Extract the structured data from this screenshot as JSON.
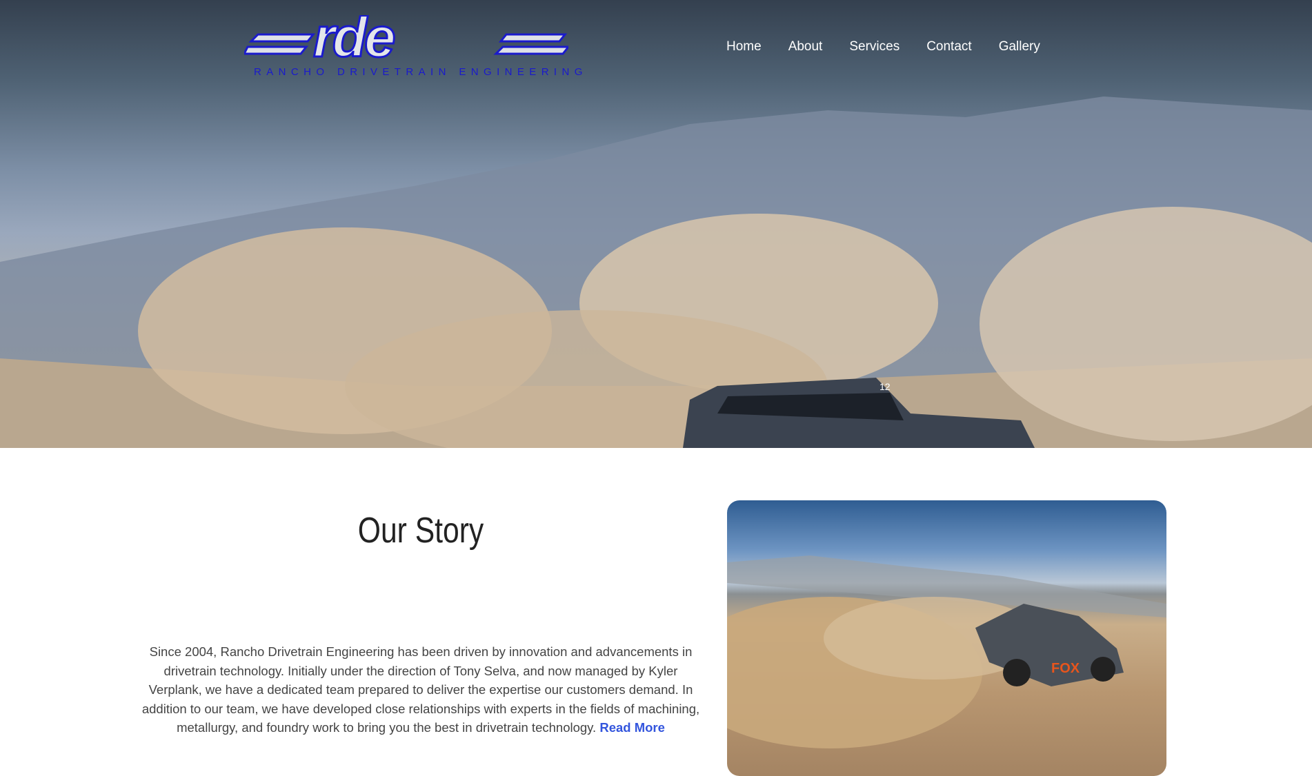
{
  "header": {
    "logo_text": "rde",
    "logo_tagline": "RANCHO DRIVETRAIN ENGINEERING",
    "nav": [
      "Home",
      "About",
      "Services",
      "Contact",
      "Gallery"
    ]
  },
  "hero": {
    "truck_number": "12"
  },
  "story": {
    "title": "Our Story",
    "body": "Since 2004, Rancho Drivetrain Engineering has been driven by innovation and advancements in drivetrain technology. Initially under the direction of Tony Selva, and now managed by Kyler Verplank,  we have a dedicated team prepared to deliver the expertise our customers demand. In addition to our team, we have developed close relationships with experts in the fields of machining, metallurgy, and foundry work to bring you the best in drivetrain technology.",
    "read_more": "Read More"
  },
  "photo": {
    "truck_brand": "FOX"
  }
}
